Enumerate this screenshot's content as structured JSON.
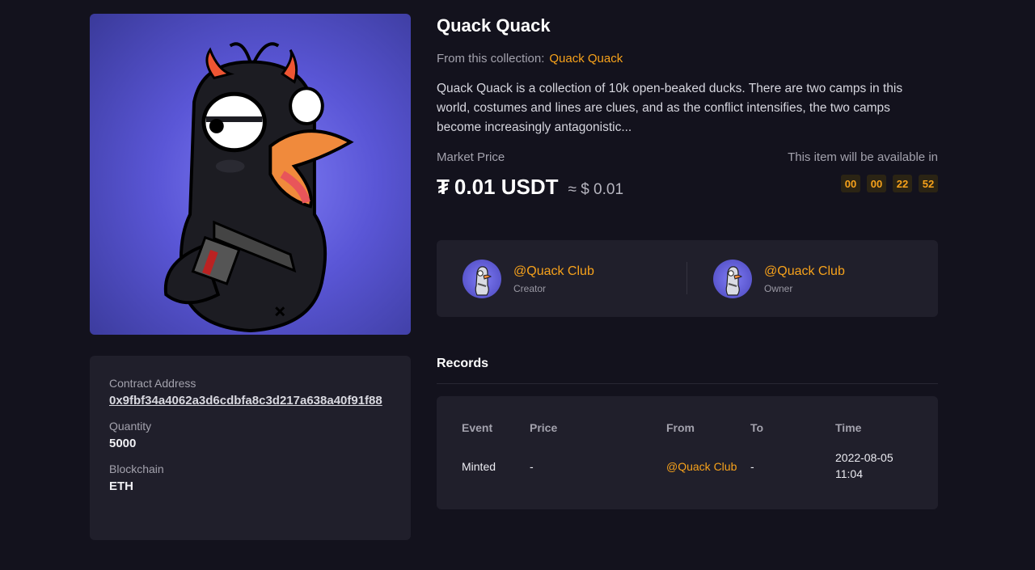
{
  "nft": {
    "title": "Quack Quack",
    "collection_prefix": "From this collection:",
    "collection_name": "Quack Quack",
    "description": "Quack Quack is a collection of 10k open-beaked ducks. There are two camps in this world, costumes and lines are clues, and as the conflict intensifies, the two camps become increasingly antagonistic..."
  },
  "price": {
    "label": "Market Price",
    "icon": "tether-icon",
    "icon_glyph": "₮",
    "amount": "0.01 USDT",
    "approx": "≈ $ 0.01"
  },
  "availability": {
    "label": "This item will be available in",
    "countdown": [
      "00",
      "00",
      "22",
      "52"
    ]
  },
  "people": [
    {
      "handle": "@Quack Club",
      "role": "Creator"
    },
    {
      "handle": "@Quack Club",
      "role": "Owner"
    }
  ],
  "details": {
    "contract_label": "Contract Address",
    "contract_value": "0x9fbf34a4062a3d6cdbfa8c3d217a638a40f91f88",
    "quantity_label": "Quantity",
    "quantity_value": "5000",
    "chain_label": "Blockchain",
    "chain_value": "ETH"
  },
  "records": {
    "title": "Records",
    "columns": [
      "Event",
      "Price",
      "From",
      "To",
      "Time"
    ],
    "rows": [
      {
        "event": "Minted",
        "price": "-",
        "from": "@Quack Club",
        "to": "-",
        "time_date": "2022-08-05",
        "time_clock": "11:04"
      }
    ]
  },
  "colors": {
    "accent": "#f7a21b",
    "background": "#13121d",
    "card": "#201f2b"
  }
}
